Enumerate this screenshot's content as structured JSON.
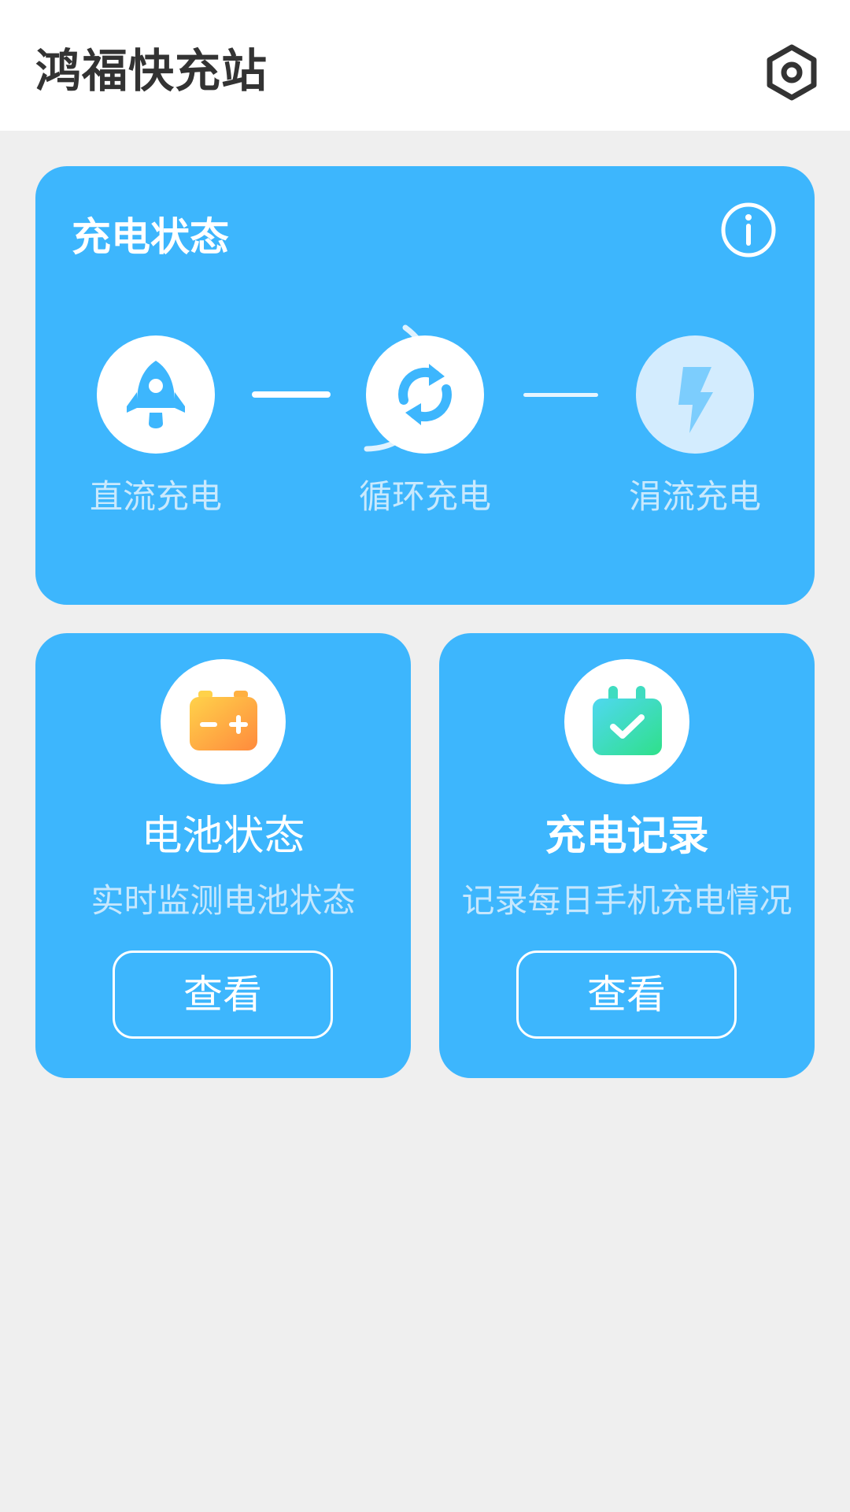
{
  "header": {
    "title": "鸿福快充站",
    "settings_icon": "settings-hexagon-icon"
  },
  "status": {
    "heading": "充电状态",
    "info_icon": "info-icon",
    "stages": [
      {
        "label": "直流充电",
        "icon": "rocket-icon",
        "state": "done"
      },
      {
        "label": "循环充电",
        "icon": "sync-icon",
        "state": "active"
      },
      {
        "label": "涓流充电",
        "icon": "lightning-icon",
        "state": "pending"
      }
    ]
  },
  "features": [
    {
      "title": "电池状态",
      "desc": "实时监测电池状态",
      "button": "查看",
      "icon": "battery-icon"
    },
    {
      "title": "充电记录",
      "desc": "记录每日手机充电情况",
      "button": "查看",
      "icon": "calendar-check-icon"
    }
  ],
  "colors": {
    "accent": "#3db6fd",
    "background": "#efefef",
    "battery_gradient": [
      "#ffd24a",
      "#ff8a3d"
    ],
    "record_gradient": [
      "#4fd8f0",
      "#2fe08a"
    ]
  }
}
